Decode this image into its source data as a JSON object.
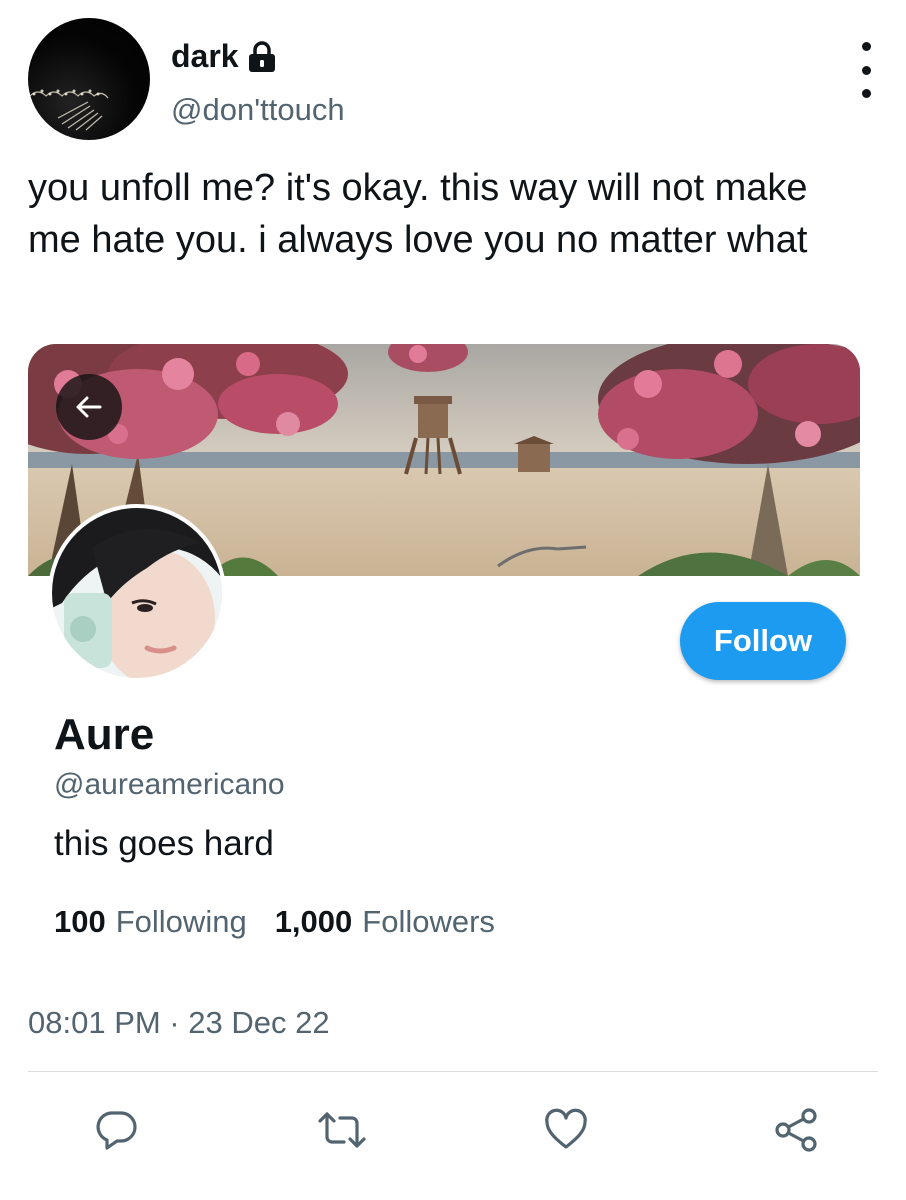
{
  "tweet": {
    "author_name": "dark",
    "author_handle": "@don'ttouch",
    "text": "you unfoll me? it's okay. this way will not make me hate you. i always love you no matter what",
    "timestamp": "08:01 PM · 23 Dec 22"
  },
  "profile_card": {
    "name": "Aure",
    "handle": "@aureamericano",
    "bio": "this goes hard",
    "follow_label": "Follow",
    "following_count": "100",
    "following_label": "Following",
    "followers_count": "1,000",
    "followers_label": "Followers"
  },
  "icons": {
    "lock": "lock-icon",
    "more": "more-vertical-icon",
    "back": "arrow-left-icon",
    "reply": "reply-icon",
    "retweet": "retweet-icon",
    "like": "heart-icon",
    "share": "share-icon"
  },
  "colors": {
    "accent": "#1d9bf0",
    "secondary_text": "#536471",
    "primary_text": "#0f1419"
  }
}
